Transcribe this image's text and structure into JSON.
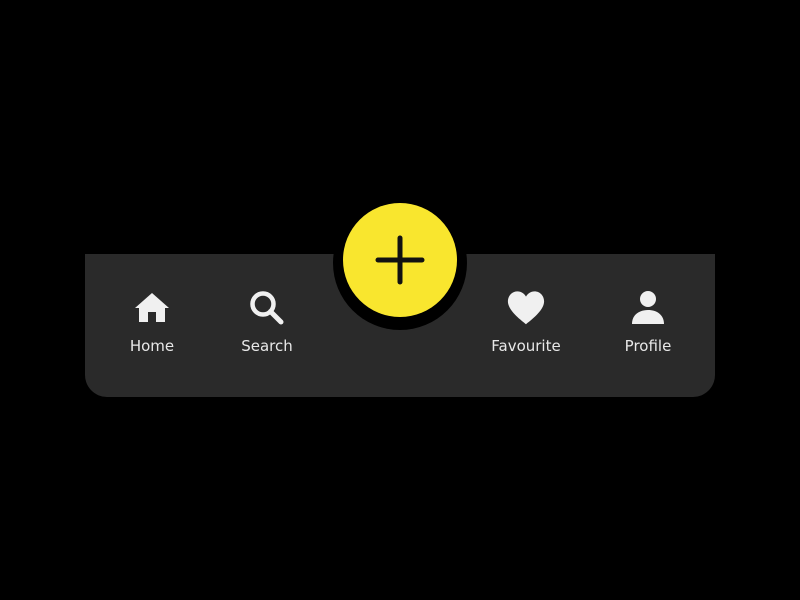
{
  "colors": {
    "background": "#000000",
    "bar": "#2a2a2a",
    "accent": "#f9e62e",
    "icon": "#f0f0f0",
    "label": "#e8e8e8"
  },
  "nav": {
    "items": [
      {
        "label": "Home",
        "icon": "home-icon"
      },
      {
        "label": "Search",
        "icon": "search-icon"
      },
      {
        "label": "Favourite",
        "icon": "heart-icon"
      },
      {
        "label": "Profile",
        "icon": "user-icon"
      }
    ]
  },
  "fab": {
    "icon": "plus-icon"
  }
}
